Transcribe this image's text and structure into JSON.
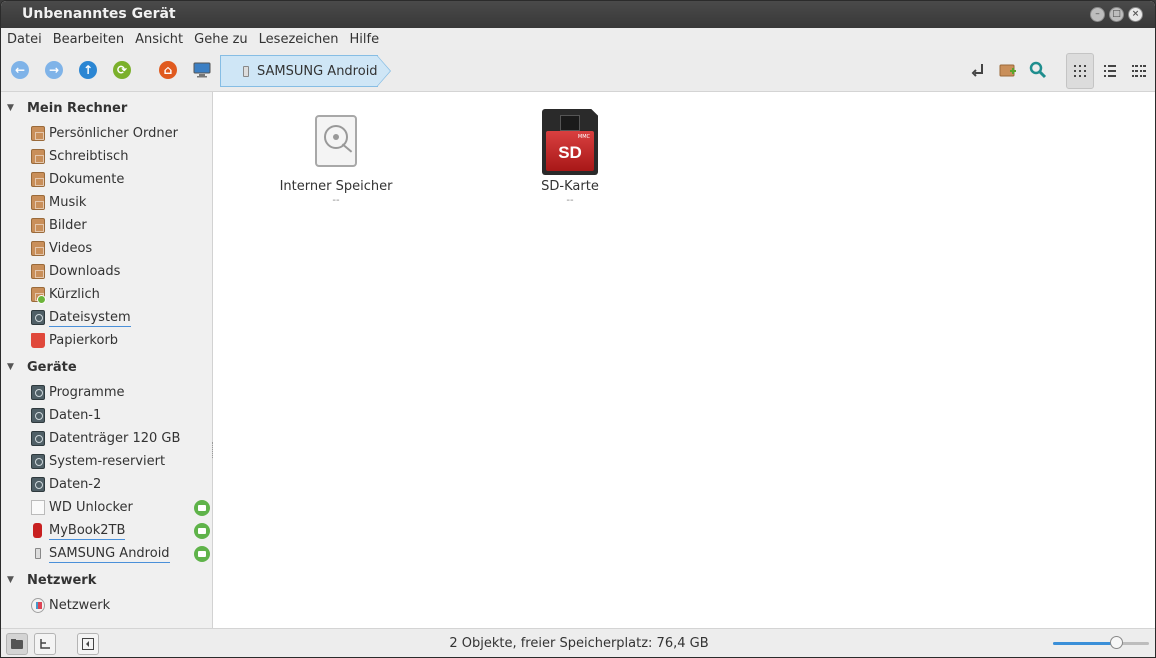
{
  "window": {
    "title": "Unbenanntes Gerät",
    "controls": [
      "minimize-icon",
      "maximize-icon",
      "close-icon"
    ]
  },
  "menubar": {
    "items": [
      "Datei",
      "Bearbeiten",
      "Ansicht",
      "Gehe zu",
      "Lesezeichen",
      "Hilfe"
    ]
  },
  "toolbar": {
    "breadcrumb_label": "SAMSUNG Android",
    "icons": [
      "back-icon",
      "forward-icon",
      "up-icon",
      "reload-icon",
      "home-icon",
      "computer-icon",
      "toggle-location-icon",
      "new-folder-icon",
      "search-icon",
      "icon-view-icon",
      "list-view-icon",
      "compact-view-icon"
    ],
    "active_view": "icon-view"
  },
  "sidebar": {
    "sections": [
      {
        "title": "Mein Rechner",
        "items": [
          {
            "label": "Persönlicher Ordner",
            "icon": "home-folder-icon"
          },
          {
            "label": "Schreibtisch",
            "icon": "desktop-folder-icon"
          },
          {
            "label": "Dokumente",
            "icon": "documents-folder-icon"
          },
          {
            "label": "Musik",
            "icon": "music-folder-icon"
          },
          {
            "label": "Bilder",
            "icon": "pictures-folder-icon"
          },
          {
            "label": "Videos",
            "icon": "videos-folder-icon"
          },
          {
            "label": "Downloads",
            "icon": "downloads-folder-icon"
          },
          {
            "label": "Kürzlich",
            "icon": "recent-folder-icon"
          },
          {
            "label": "Dateisystem",
            "icon": "filesystem-drive-icon"
          },
          {
            "label": "Papierkorb",
            "icon": "trash-icon"
          }
        ]
      },
      {
        "title": "Geräte",
        "items": [
          {
            "label": "Programme",
            "icon": "drive-icon"
          },
          {
            "label": "Daten-1",
            "icon": "drive-icon"
          },
          {
            "label": "Datenträger 120 GB",
            "icon": "drive-icon"
          },
          {
            "label": "System-reserviert",
            "icon": "drive-icon"
          },
          {
            "label": "Daten-2",
            "icon": "drive-icon"
          },
          {
            "label": "WD Unlocker",
            "icon": "optical-drive-icon"
          },
          {
            "label": "MyBook2TB",
            "icon": "usb-drive-icon"
          },
          {
            "label": "SAMSUNG Android",
            "icon": "phone-icon"
          }
        ]
      },
      {
        "title": "Netzwerk",
        "items": [
          {
            "label": "Netzwerk",
            "icon": "network-icon"
          }
        ]
      }
    ]
  },
  "main": {
    "items": [
      {
        "name": "Interner Speicher",
        "subtitle": "--",
        "icon": "hard-drive-icon"
      },
      {
        "name": "SD-Karte",
        "subtitle": "--",
        "icon": "sd-card-icon",
        "card_text": "SD",
        "card_badge": "MMC"
      }
    ]
  },
  "statusbar": {
    "text": "2 Objekte, freier Speicherplatz: 76,4 GB",
    "zoom_level": 0.66
  }
}
